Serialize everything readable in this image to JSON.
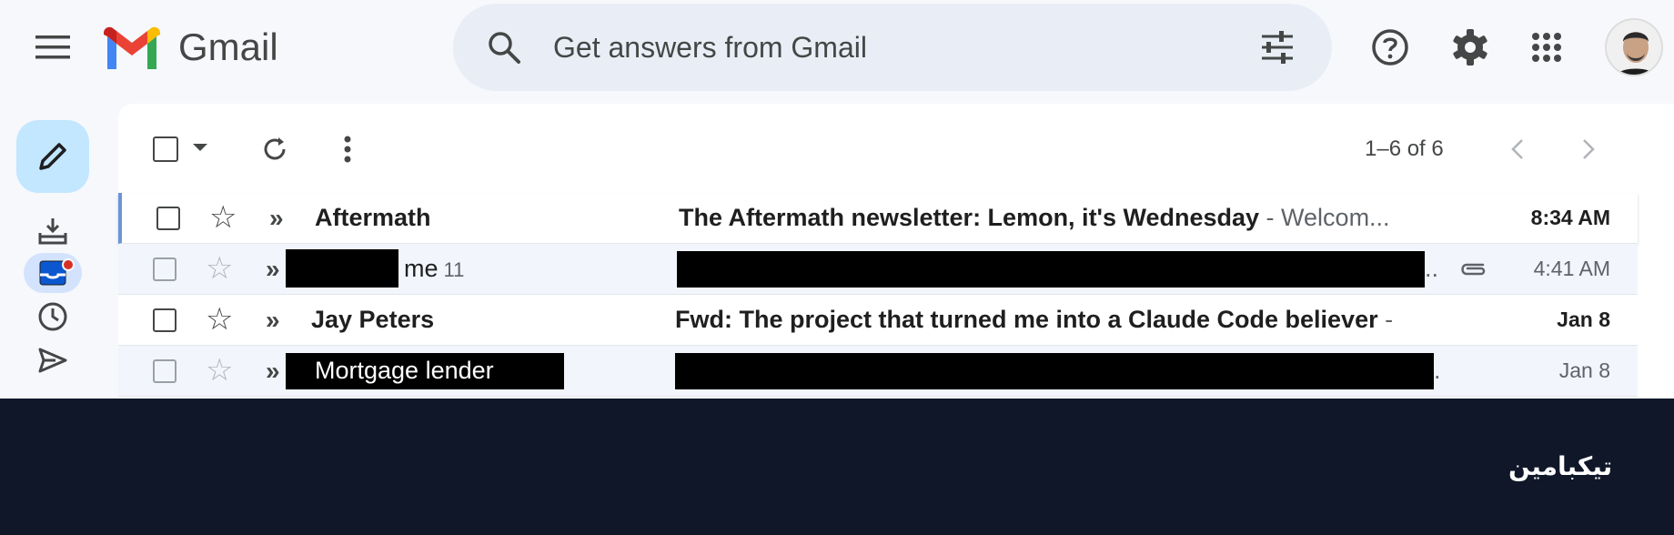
{
  "app": {
    "name": "Gmail",
    "search_placeholder": "Get answers from Gmail"
  },
  "toolbar": {
    "pager": "1–6 of 6"
  },
  "emails": [
    {
      "state": "unread",
      "sender": "Aftermath",
      "subject": "The Aftermath newsletter: Lemon, it's Wednesday",
      "snippet": " - Welcom...",
      "date": "8:34 AM"
    },
    {
      "state": "read",
      "sender": "me",
      "count": "11",
      "subject": "",
      "snippet": "..",
      "date": "4:41 AM",
      "has_attachment": true
    },
    {
      "state": "unread",
      "sender": "Jay Peters",
      "subject": "Fwd: The project that turned me into a Claude Code believer",
      "snippet": " -",
      "date": "Jan 8"
    },
    {
      "state": "read",
      "sender": "Mortgage lender",
      "subject": "",
      "snippet": ".",
      "date": "Jan 8"
    }
  ],
  "footer": {
    "brand": "تیکبامین"
  },
  "colors": {
    "accent": "#c2e7ff",
    "footer_bg": "#101729",
    "notification": "#d93025"
  }
}
